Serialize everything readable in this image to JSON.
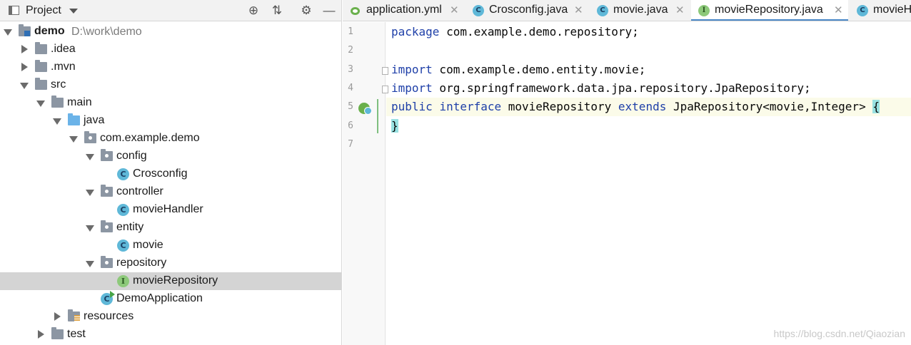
{
  "project_panel": {
    "title": "Project",
    "tree": [
      {
        "label": "demo",
        "path": "D:\\work\\demo",
        "level": 0,
        "expanded": true,
        "type": "project",
        "bold": true
      },
      {
        "label": ".idea",
        "level": 1,
        "expanded": false,
        "type": "folder"
      },
      {
        "label": ".mvn",
        "level": 1,
        "expanded": false,
        "type": "folder"
      },
      {
        "label": "src",
        "level": 1,
        "expanded": true,
        "type": "folder"
      },
      {
        "label": "main",
        "level": 2,
        "expanded": true,
        "type": "folder"
      },
      {
        "label": "java",
        "level": 3,
        "expanded": true,
        "type": "source-folder"
      },
      {
        "label": "com.example.demo",
        "level": 4,
        "expanded": true,
        "type": "package"
      },
      {
        "label": "config",
        "level": 5,
        "expanded": true,
        "type": "package"
      },
      {
        "label": "Crosconfig",
        "level": 6,
        "type": "class"
      },
      {
        "label": "controller",
        "level": 5,
        "expanded": true,
        "type": "package"
      },
      {
        "label": "movieHandler",
        "level": 6,
        "type": "class"
      },
      {
        "label": "entity",
        "level": 5,
        "expanded": true,
        "type": "package"
      },
      {
        "label": "movie",
        "level": 6,
        "type": "class"
      },
      {
        "label": "repository",
        "level": 5,
        "expanded": true,
        "type": "package"
      },
      {
        "label": "movieRepository",
        "level": 6,
        "type": "interface",
        "selected": true
      },
      {
        "label": "DemoApplication",
        "level": 5,
        "type": "app-class"
      },
      {
        "label": "resources",
        "level": 3,
        "expanded": false,
        "type": "resources-folder"
      },
      {
        "label": "test",
        "level": 2,
        "expanded": false,
        "type": "folder"
      }
    ]
  },
  "tabs": [
    {
      "label": "application.yml",
      "icon": "yaml-icon",
      "active": false
    },
    {
      "label": "Crosconfig.java",
      "icon": "class-icon",
      "active": false
    },
    {
      "label": "movie.java",
      "icon": "class-icon",
      "active": false
    },
    {
      "label": "movieRepository.java",
      "icon": "interface-icon",
      "active": true
    },
    {
      "label": "movieH",
      "icon": "class-icon",
      "active": false
    }
  ],
  "editor": {
    "line_numbers": [
      "1",
      "2",
      "3",
      "4",
      "5",
      "6",
      "7"
    ],
    "lines": [
      [
        {
          "t": "package",
          "k": true
        },
        {
          "t": " com.example.demo.repository;"
        }
      ],
      [],
      [
        {
          "t": "import",
          "k": true
        },
        {
          "t": " com.example.demo.entity.movie;"
        }
      ],
      [
        {
          "t": "import",
          "k": true
        },
        {
          "t": " org.springframework.data.jpa.repository.JpaRepository;"
        }
      ],
      [
        {
          "t": "public",
          "k": true
        },
        {
          "t": " "
        },
        {
          "t": "interface",
          "k": true
        },
        {
          "t": " movieRepository "
        },
        {
          "t": "extends",
          "k": true
        },
        {
          "t": " JpaRepository<movie,Integer> "
        },
        {
          "t": "{",
          "h": true
        }
      ],
      [
        {
          "t": "}",
          "h": true
        }
      ],
      []
    ]
  },
  "watermark": "https://blog.csdn.net/Qiaozian",
  "colors": {
    "keyword": "#1e3fa8",
    "selection": "#d4d4d4",
    "active_tab_underline": "#4a88c7",
    "brace_highlight": "#99e1e1"
  }
}
